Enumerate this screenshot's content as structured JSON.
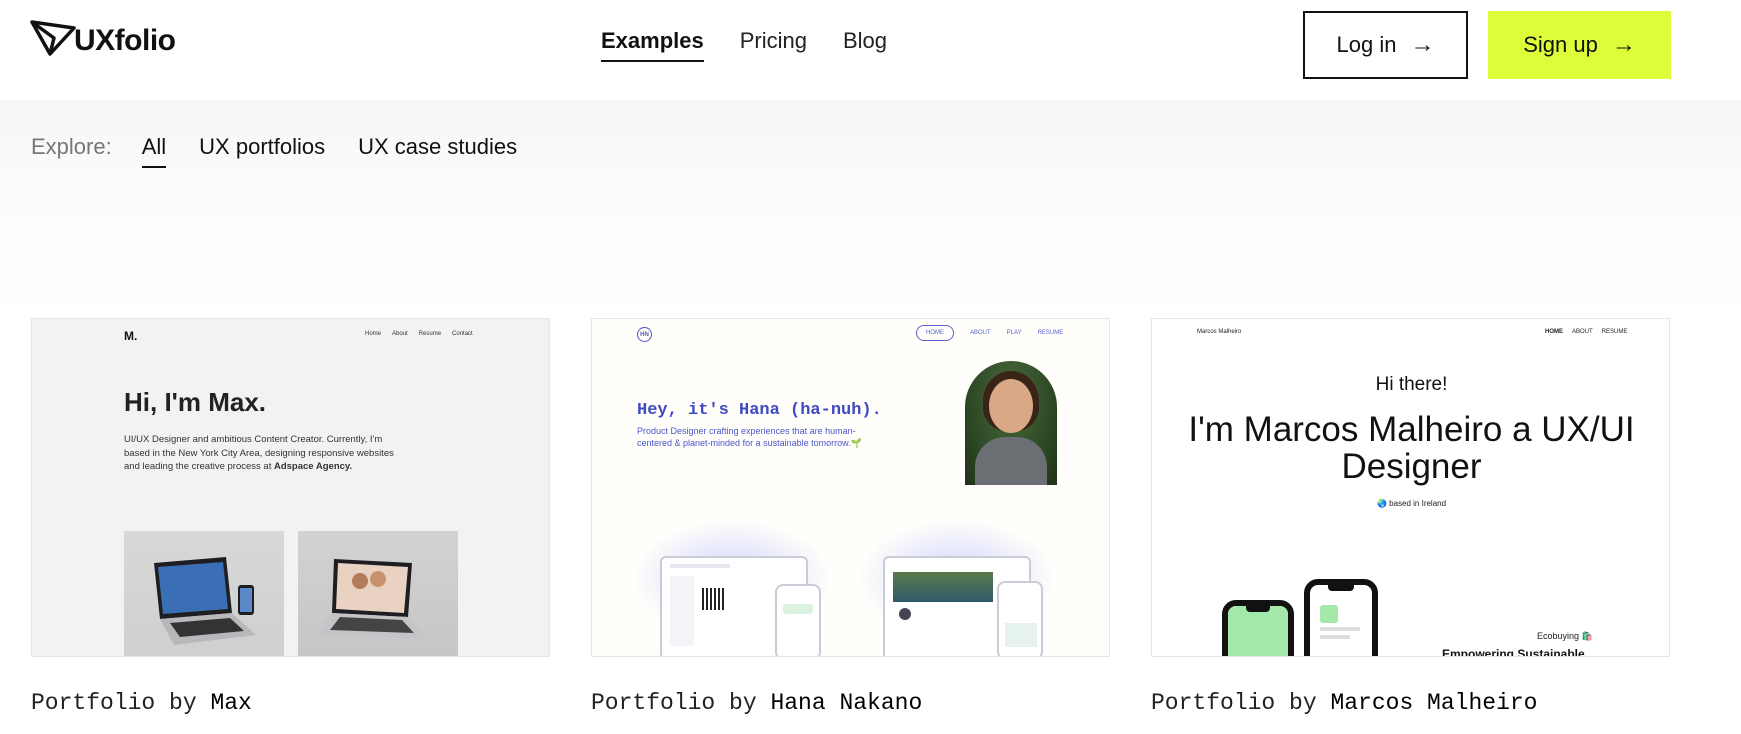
{
  "header": {
    "logo_text": "UXfolio",
    "nav": [
      {
        "label": "Examples",
        "active": true
      },
      {
        "label": "Pricing",
        "active": false
      },
      {
        "label": "Blog",
        "active": false
      }
    ],
    "login_label": "Log in",
    "signup_label": "Sign up",
    "arrow_glyph": "→",
    "accent_color": "#dffc3a"
  },
  "explore": {
    "label": "Explore:",
    "filters": [
      {
        "label": "All",
        "active": true
      },
      {
        "label": "UX portfolios",
        "active": false
      },
      {
        "label": "UX case studies",
        "active": false
      }
    ]
  },
  "cards": [
    {
      "caption_prefix": "Portfolio by ",
      "caption_name": "Max",
      "preview": {
        "logo": "M.",
        "nav": [
          "Home",
          "About",
          "Resume",
          "Contact"
        ],
        "headline": "Hi, I'm Max.",
        "intro": "UI/UX Designer and ambitious Content Creator. Currently, I'm based in the New York City Area, designing responsive websites and leading the creative process at ",
        "intro_bold": "Adspace Agency."
      }
    },
    {
      "caption_prefix": "Portfolio by ",
      "caption_name": "Hana Nakano",
      "preview": {
        "logo": "HN",
        "nav": [
          "HOME",
          "ABOUT",
          "PLAY",
          "RESUME"
        ],
        "headline": "Hey, it's Hana (ha-nuh).",
        "intro": "Product Designer crafting experiences that are human-centered & planet-minded for a sustainable tomorrow.🌱"
      }
    },
    {
      "caption_prefix": "Portfolio by ",
      "caption_name": "Marcos Malheiro",
      "preview": {
        "site_name": "Marcos Malheiro",
        "nav": [
          "HOME",
          "ABOUT",
          "RESUME"
        ],
        "greeting": "Hi there!",
        "headline": "I'm Marcos Malheiro a UX/UI Designer",
        "location": "🌏 based in Ireland",
        "project_label": "Ecobuying 🛍️",
        "project_title": "Empowering Sustainable"
      }
    }
  ]
}
